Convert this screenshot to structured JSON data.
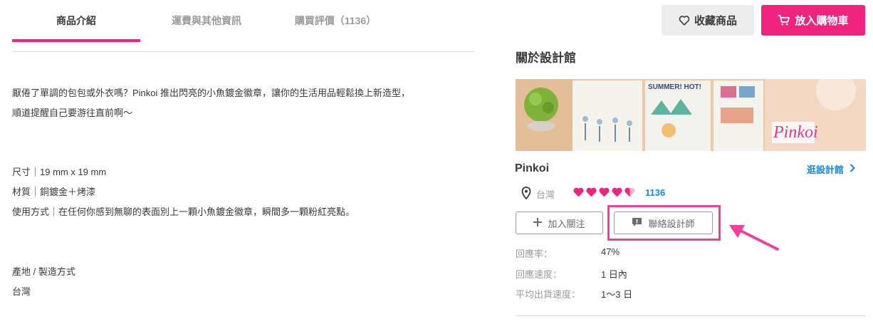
{
  "tabs": [
    {
      "label": "商品介紹"
    },
    {
      "label": "運費與其他資訊"
    },
    {
      "label": "購買評價（1136）"
    }
  ],
  "actions": {
    "favorite_label": "收藏商品",
    "cart_label": "放入購物車"
  },
  "description": {
    "intro": [
      "厭倦了單調的包包或外衣嗎？Pinkoi 推出閃亮的小魚鍍金徽章，讓你的生活用品輕鬆換上新造型，",
      "順道提醒自己要游往直前啊～"
    ],
    "specs": [
      "尺寸｜19 mm x 19 mm",
      "材質｜銅鍍金＋烤漆",
      "使用方式｜在任何你感到無聊的表面別上一顆小魚鍍金徽章，瞬間多一顆粉紅亮點。"
    ],
    "origin_label": "產地 / 製造方式",
    "origin_value": "台灣"
  },
  "shop": {
    "section_title": "關於設計館",
    "banner_text": {
      "summer": "SUMMER! HOT!",
      "brand": "Pinkoi"
    },
    "name": "Pinkoi",
    "visit_label": "逛設計館",
    "location": "台灣",
    "rating": 4.5,
    "review_count": "1136",
    "follow_label": "加入關注",
    "contact_label": "聯絡設計師",
    "stats": [
      {
        "label": "回應率：",
        "value": "47%"
      },
      {
        "label": "回應速度：",
        "value": "1 日內"
      },
      {
        "label": "平均出貨速度：",
        "value": "1～3 日"
      }
    ]
  },
  "colors": {
    "accent": "#f0247e",
    "link": "#1f86d5",
    "highlight": "#f0409a"
  }
}
